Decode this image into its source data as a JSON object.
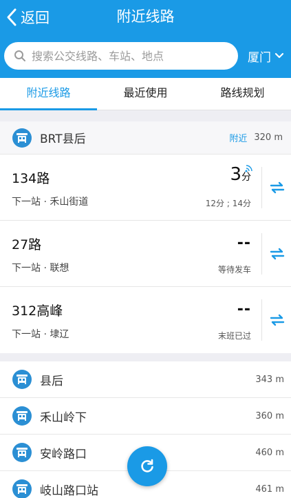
{
  "header": {
    "back_label": "返回",
    "title": "附近线路"
  },
  "search": {
    "placeholder": "搜索公交线路、车站、地点",
    "value": "",
    "city": "厦门"
  },
  "tabs": [
    {
      "label": "附近线路",
      "active": true
    },
    {
      "label": "最近使用",
      "active": false
    },
    {
      "label": "路线规划",
      "active": false
    }
  ],
  "station_group": {
    "name": "BRT县后",
    "nearby_label": "附近",
    "distance": "320 m",
    "routes": [
      {
        "name": "134路",
        "next": "下一站 · 禾山街道",
        "eta": "3",
        "eta_unit": "分",
        "sub": "12分 ; 14分"
      },
      {
        "name": "27路",
        "next": "下一站 · 联想",
        "eta": "--",
        "sub": "等待发车"
      },
      {
        "name": "312高峰",
        "next": "下一站 · 埭辽",
        "eta": "--",
        "sub": "末班已过"
      }
    ]
  },
  "stations": [
    {
      "name": "县后",
      "distance": "343 m"
    },
    {
      "name": "禾山岭下",
      "distance": "360 m"
    },
    {
      "name": "安岭路口",
      "distance": "460 m"
    },
    {
      "name": "岐山路口站",
      "distance": "461 m"
    }
  ],
  "colors": {
    "primary": "#1a9ae6",
    "station_icon": "#2b8fd4"
  },
  "icons": {
    "back": "chevron-left-icon",
    "search": "search-icon",
    "city_dropdown": "chevron-down-icon",
    "station": "bus-station-icon",
    "realtime": "signal-icon",
    "swap": "swap-arrows-icon",
    "refresh": "refresh-icon"
  }
}
